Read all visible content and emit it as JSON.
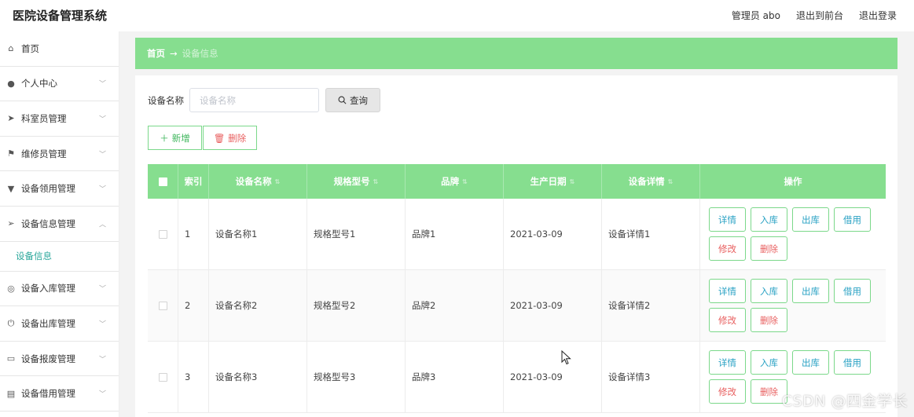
{
  "header": {
    "title": "医院设备管理系统",
    "user": "管理员 abo",
    "exit_front": "退出到前台",
    "logout": "退出登录"
  },
  "sidebar": {
    "items": [
      {
        "label": "首页",
        "icon": "home-icon",
        "glyph": "⌂",
        "chevron": false
      },
      {
        "label": "个人中心",
        "icon": "user-icon",
        "glyph": "●",
        "chevron": true
      },
      {
        "label": "科室员管理",
        "icon": "paper-plane-icon",
        "glyph": "➤",
        "chevron": true
      },
      {
        "label": "维修员管理",
        "icon": "flag-icon",
        "glyph": "⚑",
        "chevron": true
      },
      {
        "label": "设备领用管理",
        "icon": "tag-icon",
        "glyph": "▼",
        "chevron": true
      },
      {
        "label": "设备信息管理",
        "icon": "navigation-icon",
        "glyph": "➢",
        "chevron": true,
        "expanded": true
      },
      {
        "label": "设备入库管理",
        "icon": "globe-icon",
        "glyph": "◎",
        "chevron": true
      },
      {
        "label": "设备出库管理",
        "icon": "power-icon",
        "glyph": "⏻",
        "chevron": true
      },
      {
        "label": "设备报废管理",
        "icon": "monitor-icon",
        "glyph": "▭",
        "chevron": true
      },
      {
        "label": "设备借用管理",
        "icon": "document-icon",
        "glyph": "▤",
        "chevron": true
      }
    ],
    "sub_item": "设备信息"
  },
  "breadcrumb": {
    "home": "首页",
    "arrow": "→",
    "current": "设备信息"
  },
  "search": {
    "label": "设备名称",
    "placeholder": "设备名称",
    "value": "",
    "button": "查询"
  },
  "actions": {
    "add": "新增",
    "delete": "删除"
  },
  "table": {
    "headers": [
      "索引",
      "设备名称",
      "规格型号",
      "品牌",
      "生产日期",
      "设备详情",
      "操作"
    ],
    "rows": [
      {
        "index": "1",
        "name": "设备名称1",
        "model": "规格型号1",
        "brand": "品牌1",
        "date": "2021-03-09",
        "detail": "设备详情1"
      },
      {
        "index": "2",
        "name": "设备名称2",
        "model": "规格型号2",
        "brand": "品牌2",
        "date": "2021-03-09",
        "detail": "设备详情2"
      },
      {
        "index": "3",
        "name": "设备名称3",
        "model": "规格型号3",
        "brand": "品牌3",
        "date": "2021-03-09",
        "detail": "设备详情3"
      }
    ],
    "row_actions": [
      "详情",
      "入库",
      "出库",
      "借用",
      "修改",
      "删除"
    ]
  },
  "watermark": "CSDN @四金学长",
  "colors": {
    "accent": "#86de8f",
    "sub_active": "#2aa79b",
    "danger": "#e85f5f",
    "info": "#2aa2c4"
  }
}
